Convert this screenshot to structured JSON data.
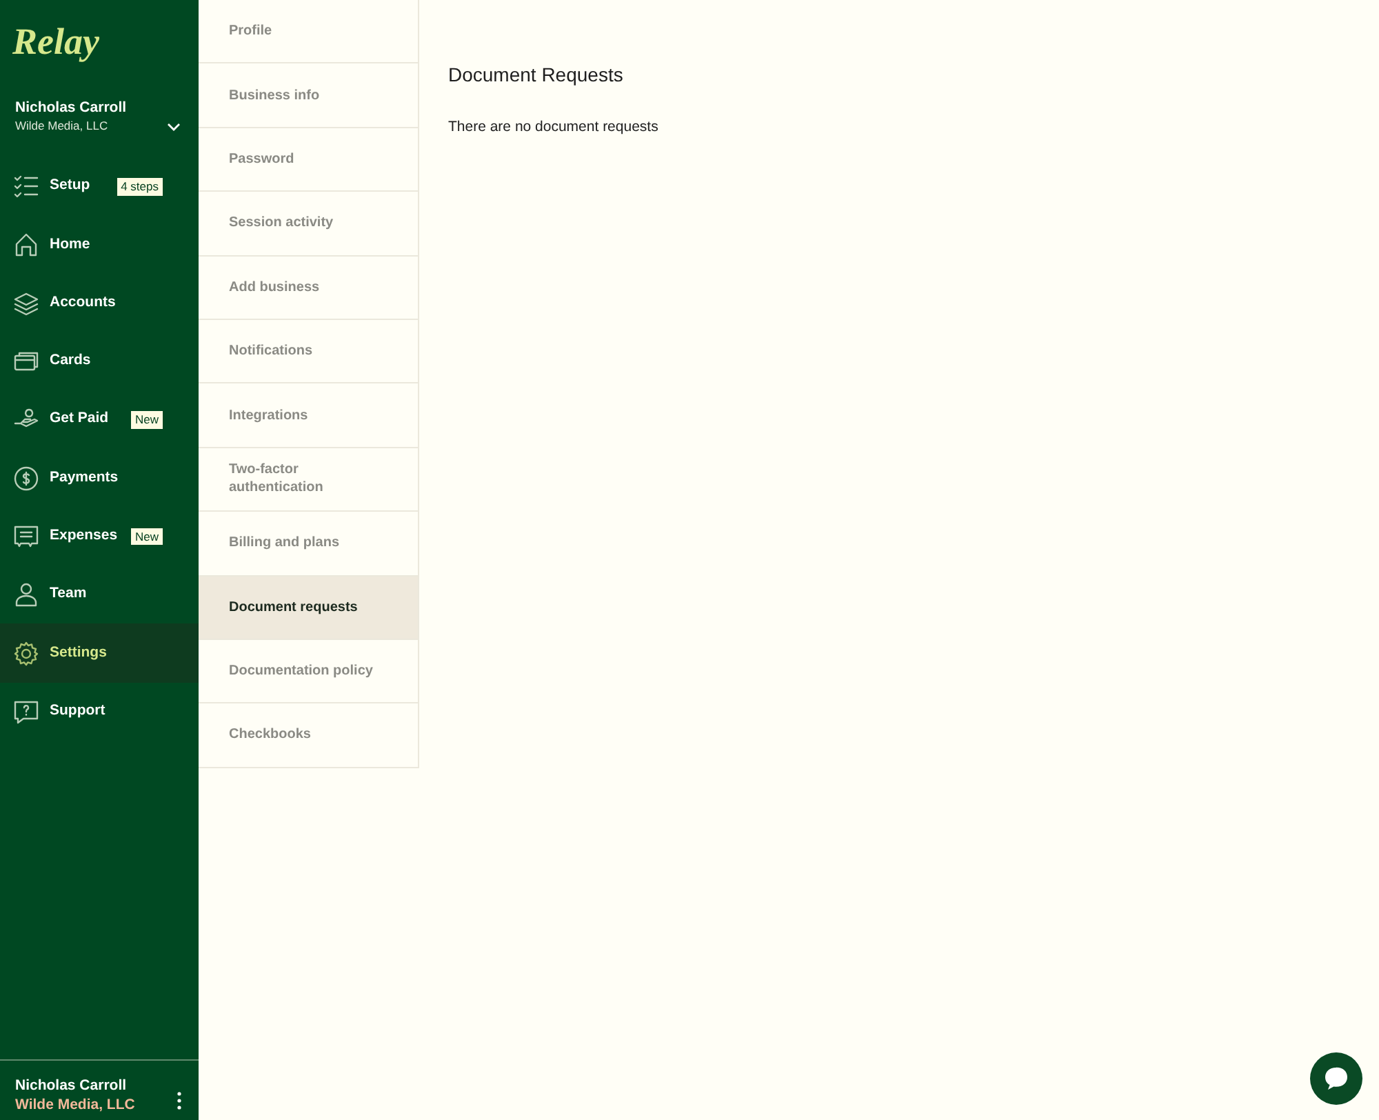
{
  "sidebar": {
    "logo": "Relay",
    "account": {
      "name": "Nicholas Carroll",
      "company": "Wilde Media, LLC",
      "expanded": false
    },
    "items": [
      {
        "kind": "setup",
        "label": "Setup",
        "badge": "4 steps",
        "selected": false
      },
      {
        "kind": "home",
        "label": "Home",
        "selected": false
      },
      {
        "kind": "accounts",
        "label": "Accounts",
        "selected": false
      },
      {
        "kind": "cards",
        "label": "Cards",
        "selected": false
      },
      {
        "kind": "getpaid",
        "label": "Get Paid",
        "badge": "New",
        "selected": false
      },
      {
        "kind": "payments",
        "label": "Payments",
        "selected": false
      },
      {
        "kind": "expenses",
        "label": "Expenses",
        "badge": "New",
        "selected": false
      },
      {
        "kind": "team",
        "label": "Team",
        "selected": false
      },
      {
        "kind": "settings",
        "label": "Settings",
        "selected": true
      },
      {
        "kind": "support",
        "label": "Support",
        "selected": false
      }
    ],
    "footer": {
      "name": "Nicholas Carroll",
      "company": "Wilde Media, LLC"
    }
  },
  "settings_menu": [
    {
      "label": "Profile",
      "selected": false
    },
    {
      "label": "Business info",
      "selected": false
    },
    {
      "label": "Password",
      "selected": false
    },
    {
      "label": "Session activity",
      "selected": false
    },
    {
      "label": "Add business",
      "selected": false
    },
    {
      "label": "Notifications",
      "selected": false
    },
    {
      "label": "Integrations",
      "selected": false
    },
    {
      "label": "Two-factor authentication",
      "selected": false
    },
    {
      "label": "Billing and plans",
      "selected": false
    },
    {
      "label": "Document requests",
      "selected": true
    },
    {
      "label": "Documentation policy",
      "selected": false
    },
    {
      "label": "Checkbooks",
      "selected": false
    }
  ],
  "content": {
    "title": "Document Requests",
    "message": "There are no document requests"
  }
}
